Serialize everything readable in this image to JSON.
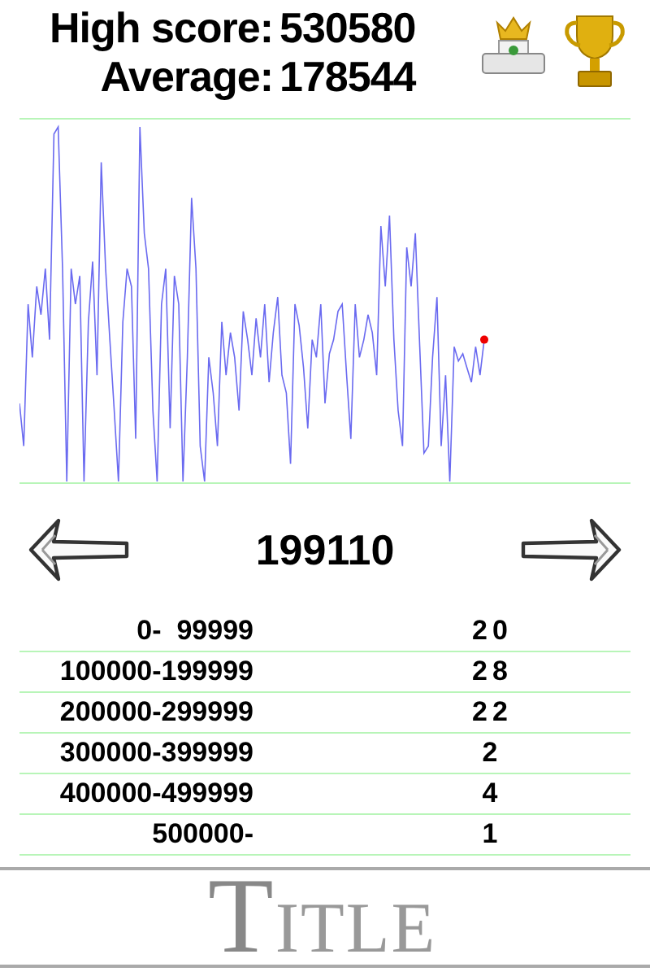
{
  "header": {
    "high_score_label": "High score:",
    "high_score": "530580",
    "average_label": "Average:",
    "average": "178544"
  },
  "navigator": {
    "value": "199110"
  },
  "distribution": [
    {
      "range": "0-  99999",
      "count": "20"
    },
    {
      "range": "100000-199999",
      "count": "28"
    },
    {
      "range": "200000-299999",
      "count": "22"
    },
    {
      "range": "300000-399999",
      "count": "2"
    },
    {
      "range": "400000-499999",
      "count": "4"
    },
    {
      "range": "500000-",
      "count": "1"
    }
  ],
  "footer": {
    "title": "TITLE"
  }
}
